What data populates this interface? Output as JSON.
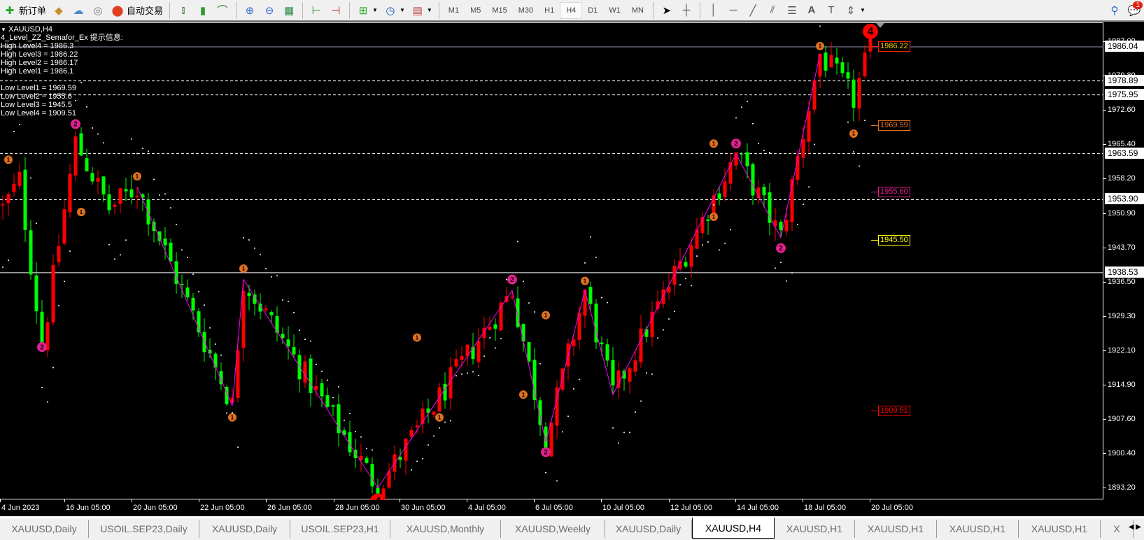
{
  "toolbar": {
    "new_order": "新订单",
    "auto_trading": "自动交易",
    "timeframes": [
      "M1",
      "M5",
      "M15",
      "M30",
      "H1",
      "H4",
      "D1",
      "W1",
      "MN"
    ],
    "active_timeframe": "H4",
    "notification_count": "1"
  },
  "chart": {
    "symbol_title": "XAUUSD,H4",
    "indicator_title": "4_Level_ZZ_Semafor_Ex 提示信息:",
    "info_lines": [
      "High Level4 = 1986.3",
      "High Level3 = 1986.22",
      "High Level2 = 1986.17",
      "High Level1 = 1986.1",
      "",
      "Low Level1 = 1969.59",
      "Low Level2 = 1955.6",
      "Low Level3 = 1945.5",
      "Low Level4 = 1909.51"
    ],
    "price_scale": [
      "1987.00",
      "1979.80",
      "1972.60",
      "1965.40",
      "1958.20",
      "1950.90",
      "1943.70",
      "1936.50",
      "1929.30",
      "1922.10",
      "1914.90",
      "1907.60",
      "1900.40",
      "1893.20"
    ],
    "price_range": [
      1890.0,
      1991.0
    ],
    "price_lines": [
      {
        "price": "1986.04",
        "style": "solid",
        "color": "#8a94a6"
      },
      {
        "price": "1978.89",
        "style": "dashed",
        "color": "#ffffff"
      },
      {
        "price": "1975.95",
        "style": "dashed",
        "color": "#ffffff"
      },
      {
        "price": "1963.59",
        "style": "dashed",
        "color": "#ffffff"
      },
      {
        "price": "1953.90",
        "style": "dashed",
        "color": "#ffffff"
      },
      {
        "price": "1938.53",
        "style": "solid",
        "color": "#ffffff"
      }
    ],
    "level_labels": [
      {
        "text": "1986.22",
        "color": "#ffd000",
        "border": "#ff2000"
      },
      {
        "text": "1969.59",
        "color": "#e07020",
        "border": "#e07020"
      },
      {
        "text": "1955.60",
        "color": "#e0208f",
        "border": "#e0208f"
      },
      {
        "text": "1945.50",
        "color": "#ffff00",
        "border": "#ffff00"
      },
      {
        "text": "1909.51",
        "color": "#ff0000",
        "border": "#ff0000"
      }
    ],
    "time_labels": [
      "4 Jun 2023",
      "16 Jun 05:00",
      "20 Jun 05:00",
      "22 Jun 05:00",
      "26 Jun 05:00",
      "28 Jun 05:00",
      "30 Jun 05:00",
      "4 Jul 05:00",
      "6 Jul 05:00",
      "10 Jul 05:00",
      "12 Jul 05:00",
      "14 Jul 05:00",
      "18 Jul 05:00",
      "20 Jul 05:00"
    ],
    "bar_count": 156,
    "price_path": [
      [
        0,
        1952
      ],
      [
        3,
        1958
      ],
      [
        7,
        1923
      ],
      [
        13,
        1966
      ],
      [
        19,
        1952
      ],
      [
        24,
        1956.6
      ],
      [
        41,
        1910.6
      ],
      [
        43,
        1937.1
      ],
      [
        67,
        1893.3
      ],
      [
        91,
        1934.8
      ],
      [
        97,
        1902.9
      ],
      [
        104,
        1934.8
      ],
      [
        109,
        1912.9
      ],
      [
        127,
        1954.3
      ],
      [
        131,
        1963.5
      ],
      [
        139,
        1945.9
      ],
      [
        146,
        1984.6
      ],
      [
        152,
        1975
      ],
      [
        155,
        1986.2
      ]
    ],
    "zigzag": [
      [
        24,
        1956.6
      ],
      [
        41,
        1910.6
      ],
      [
        43,
        1937.1
      ],
      [
        67,
        1893.3
      ],
      [
        91,
        1934.8
      ],
      [
        97,
        1902.9
      ],
      [
        104,
        1934.8
      ],
      [
        109,
        1912.9
      ],
      [
        127,
        1954.3
      ],
      [
        131,
        1963.5
      ],
      [
        139,
        1945.9
      ],
      [
        146,
        1984.6
      ]
    ],
    "semafor": [
      {
        "bar": 1,
        "price": 1962.3,
        "level": "1"
      },
      {
        "bar": 14,
        "price": 1951.3,
        "level": "1"
      },
      {
        "bar": 24,
        "price": 1958.8,
        "level": "1"
      },
      {
        "bar": 43,
        "price": 1939.4,
        "level": "1"
      },
      {
        "bar": 41,
        "price": 1908.1,
        "level": "1"
      },
      {
        "bar": 74,
        "price": 1924.9,
        "level": "1"
      },
      {
        "bar": 78,
        "price": 1908.1,
        "level": "1"
      },
      {
        "bar": 97,
        "price": 1929.6,
        "level": "1"
      },
      {
        "bar": 93,
        "price": 1912.9,
        "level": "1"
      },
      {
        "bar": 104,
        "price": 1936.8,
        "level": "1"
      },
      {
        "bar": 127,
        "price": 1965.7,
        "level": "1"
      },
      {
        "bar": 127,
        "price": 1950.3,
        "level": "1"
      },
      {
        "bar": 146,
        "price": 1986.2,
        "level": "1"
      },
      {
        "bar": 152,
        "price": 1967.8,
        "level": "1"
      },
      {
        "bar": 13,
        "price": 1969.8,
        "level": "2"
      },
      {
        "bar": 7,
        "price": 1922.9,
        "level": "2"
      },
      {
        "bar": 91,
        "price": 1937.1,
        "level": "2"
      },
      {
        "bar": 97,
        "price": 1900.8,
        "level": "2"
      },
      {
        "bar": 131,
        "price": 1965.7,
        "level": "2"
      },
      {
        "bar": 139,
        "price": 1943.7,
        "level": "2"
      },
      {
        "bar": 155,
        "price": 1989.3,
        "level": "4"
      },
      {
        "bar": 67,
        "price": 1890.5,
        "level": "4"
      }
    ],
    "colors": {
      "bull": "#ff0000",
      "bear": "#00ff00",
      "zigzag": "#ff00ff",
      "sar": "#ffffff",
      "level1": "#e07020",
      "level2": "#e0208f",
      "level4": "#ff0000"
    }
  },
  "tabs": [
    {
      "label": "XAUUSD,Daily"
    },
    {
      "label": "USOIL.SEP23,Daily"
    },
    {
      "label": "XAUUSD,Daily"
    },
    {
      "label": "USOIL.SEP23,H1"
    },
    {
      "label": "XAUUSD,Monthly"
    },
    {
      "label": "XAUUSD,Weekly"
    },
    {
      "label": "XAUUSD,Daily"
    },
    {
      "label": "XAUUSD,H4",
      "active": true
    },
    {
      "label": "XAUUSD,H1"
    },
    {
      "label": "XAUUSD,H1"
    },
    {
      "label": "XAUUSD,H1"
    },
    {
      "label": "XAUUSD,H1"
    },
    {
      "label": "X"
    }
  ]
}
